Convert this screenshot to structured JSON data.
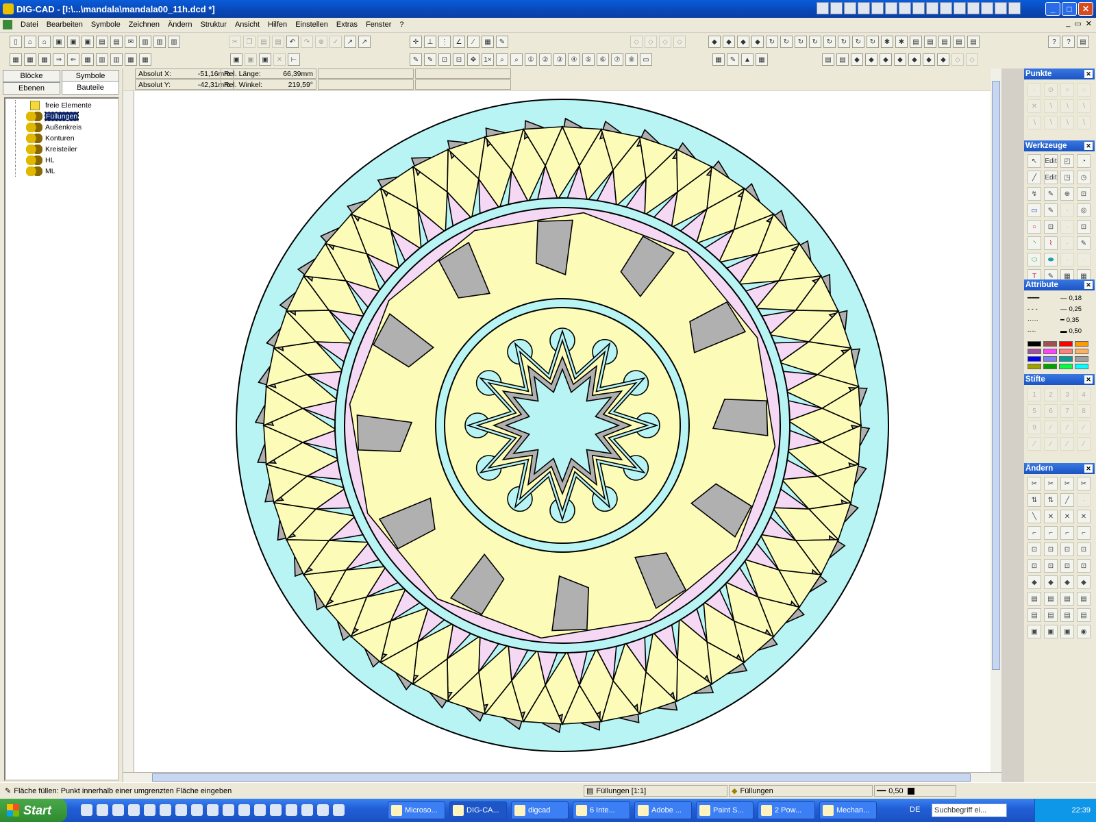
{
  "window": {
    "title": "DIG-CAD - [I:\\...\\mandala\\mandala00_11h.dcd *]"
  },
  "menu": [
    "Datei",
    "Bearbeiten",
    "Symbole",
    "Zeichnen",
    "Ändern",
    "Struktur",
    "Ansicht",
    "Hilfen",
    "Einstellen",
    "Extras",
    "Fenster",
    "?"
  ],
  "tabs": {
    "bloecke": "Blöcke",
    "symbole": "Symbole",
    "ebenen": "Ebenen",
    "bauteile": "Bauteile"
  },
  "tree": [
    {
      "label": "freie Elemente",
      "type": "folder",
      "selected": false
    },
    {
      "label": "Füllungen",
      "type": "component",
      "selected": true
    },
    {
      "label": "Außenkreis",
      "type": "component",
      "selected": false
    },
    {
      "label": "Konturen",
      "type": "component",
      "selected": false
    },
    {
      "label": "Kreisteiler",
      "type": "component",
      "selected": false
    },
    {
      "label": "HL",
      "type": "component",
      "selected": false
    },
    {
      "label": "ML",
      "type": "component",
      "selected": false
    }
  ],
  "coords": {
    "abs_x_label": "Absolut X:",
    "abs_x": "-51,16mm",
    "abs_y_label": "Absolut Y:",
    "abs_y": "-42,31mm",
    "rel_len_label": "Rel. Länge:",
    "rel_len": "66,39mm",
    "rel_angle_label": "Rel. Winkel:",
    "rel_angle": "219,59°"
  },
  "panels": {
    "punkte": "Punkte",
    "werkzeuge": "Werkzeuge",
    "attribute": "Attribute",
    "stifte": "Stifte",
    "aendern": "Ändern",
    "edit1": "Edit",
    "edit2": "Edit",
    "linewidths": [
      "0,18",
      "0,25",
      "0,35",
      "0,50"
    ],
    "swatches": [
      "#000000",
      "#a05050",
      "#ff0000",
      "#ff9900",
      "#a050a0",
      "#ff40ff",
      "#ff8080",
      "#ffb060",
      "#0000ff",
      "#8080ff",
      "#00a0a0",
      "#a0a0a0",
      "#a0a000",
      "#00a000",
      "#00ff40",
      "#00ffff"
    ]
  },
  "mandala": {
    "colors": {
      "cyan": "#b8f4f4",
      "yellow": "#fcfcb8",
      "pink": "#f4d8f4",
      "gray": "#b0b0b0"
    }
  },
  "status": {
    "hint": "Fläche füllen: Punkt innerhalb einer umgrenzten Fläche eingeben",
    "layer": "Füllungen [1:1]",
    "component": "Füllungen",
    "pen": "0,50"
  },
  "taskbar": {
    "start": "Start",
    "tasks": [
      "Microso...",
      "DIG-CA...",
      "digcad",
      "6 Inte...",
      "Adobe ...",
      "Paint S...",
      "2 Pow...",
      "Mechan..."
    ],
    "lang": "DE",
    "search": "Suchbegriff ei...",
    "clock": "22:39"
  }
}
